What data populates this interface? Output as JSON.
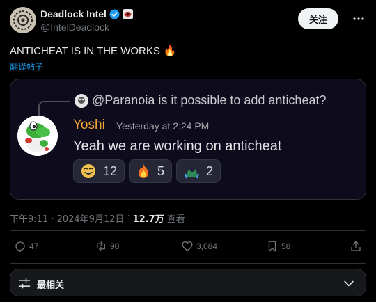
{
  "author": {
    "name": "Deadlock Intel",
    "handle": "@IntelDeadlock",
    "follow_label": "关注"
  },
  "tweet": {
    "text": "ANTICHEAT IS IN THE WORKS",
    "emoji": "🔥",
    "translate_label": "翻译帖子",
    "timestamp": "下午9:11 · 2024年9月12日",
    "views": "12.7万",
    "views_label": "查看"
  },
  "embedded_message": {
    "reply_to_text": "@Paranoia is it possible to add anticheat?",
    "author": "Yoshi",
    "time": "Yesterday at 2:24 PM",
    "body": "Yeah we are working on anticheat",
    "reactions": [
      {
        "icon": "laughing-face-icon",
        "count": "12"
      },
      {
        "icon": "fire-icon",
        "count": "5"
      },
      {
        "icon": "crying-figure-icon",
        "count": "2"
      }
    ]
  },
  "actions": {
    "replies": "47",
    "reposts": "90",
    "likes": "3,084",
    "bookmarks": "58"
  },
  "sort": {
    "label": "最相关"
  },
  "colors": {
    "accent": "#1d9bf0",
    "yoshi_name": "#f2a33a",
    "verified": "#1d9bf0"
  }
}
